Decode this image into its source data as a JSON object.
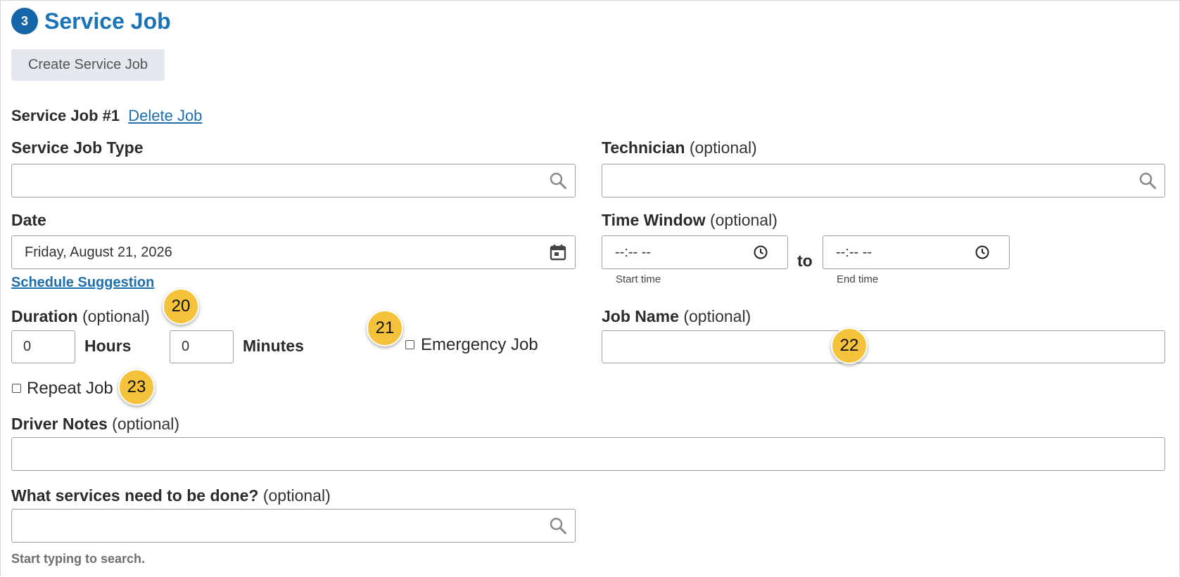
{
  "section": {
    "step_number": "3",
    "title": "Service Job"
  },
  "create_button_label": "Create Service Job",
  "job": {
    "heading": "Service Job #1",
    "delete_label": "Delete Job"
  },
  "service_job_type": {
    "label": "Service Job Type",
    "value": "",
    "icon": "search-icon"
  },
  "technician": {
    "label": "Technician",
    "optional": "(optional)",
    "value": "",
    "icon": "search-icon"
  },
  "date": {
    "label": "Date",
    "value": "Friday, August 21, 2026",
    "icon": "calendar-icon"
  },
  "schedule_suggestion_label": "Schedule Suggestion",
  "time_window": {
    "label": "Time Window",
    "optional": "(optional)",
    "start_value": "--:-- --",
    "end_value": "--:-- --",
    "separator": "to",
    "start_caption": "Start time",
    "end_caption": "End time",
    "icon": "clock-icon"
  },
  "duration": {
    "label": "Duration",
    "optional": "(optional)",
    "hours_value": "0",
    "hours_label": "Hours",
    "minutes_value": "0",
    "minutes_label": "Minutes"
  },
  "emergency_job": {
    "label": "Emergency Job",
    "checked": false
  },
  "job_name": {
    "label": "Job Name",
    "optional": "(optional)",
    "value": ""
  },
  "repeat_job": {
    "label": "Repeat Job",
    "checked": false
  },
  "driver_notes": {
    "label": "Driver Notes",
    "optional": "(optional)",
    "value": ""
  },
  "services": {
    "label": "What services need to be done?",
    "optional": "(optional)",
    "value": "",
    "hint": "Start typing to search.",
    "icon": "search-icon"
  },
  "callouts": [
    "20",
    "21",
    "22",
    "23"
  ],
  "colors": {
    "accent": "#1466a8",
    "link": "#1f6fad",
    "callout": "#f5c33b",
    "button_bg": "#e5e8ee"
  }
}
